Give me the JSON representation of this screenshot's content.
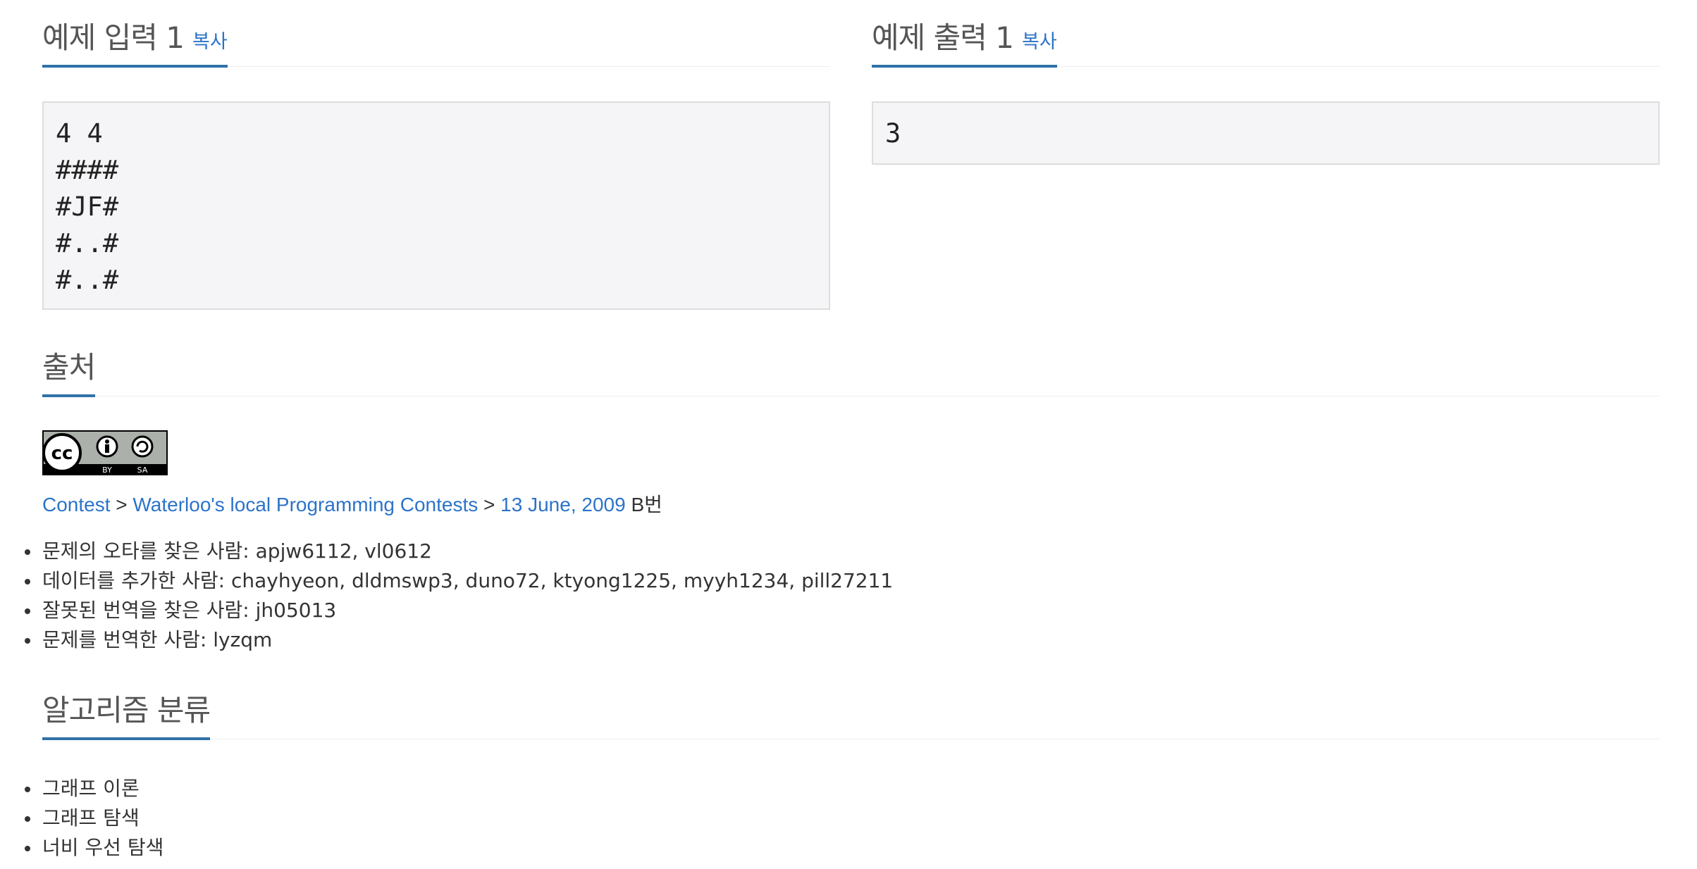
{
  "sample_input": {
    "title": "예제 입력 1",
    "copy_label": "복사",
    "content": "4 4\n####\n#JF#\n#..#\n#..#"
  },
  "sample_output": {
    "title": "예제 출력 1",
    "copy_label": "복사",
    "content": "3"
  },
  "source": {
    "title": "출처",
    "license_badge": {
      "icon": "cc-by-sa-icon",
      "by_text": "BY",
      "sa_text": "SA"
    },
    "breadcrumb": {
      "contest": "Contest",
      "sep1": " > ",
      "series": "Waterloo's local Programming Contests",
      "sep2": " > ",
      "date": "13 June, 2009",
      "suffix": " B번"
    },
    "credits": [
      "문제의 오타를 찾은 사람: apjw6112, vl0612",
      "데이터를 추가한 사람: chayhyeon, dldmswp3, duno72, ktyong1225, myyh1234, pill27211",
      "잘못된 번역을 찾은 사람: jh05013",
      "문제를 번역한 사람: lyzqm"
    ]
  },
  "algorithm": {
    "title": "알고리즘 분류",
    "tags": [
      "그래프 이론",
      "그래프 탐색",
      "너비 우선 탐색"
    ]
  },
  "colors": {
    "accent": "#3071a9",
    "link": "#2c73c9",
    "sample_bg": "#f5f5f7"
  }
}
